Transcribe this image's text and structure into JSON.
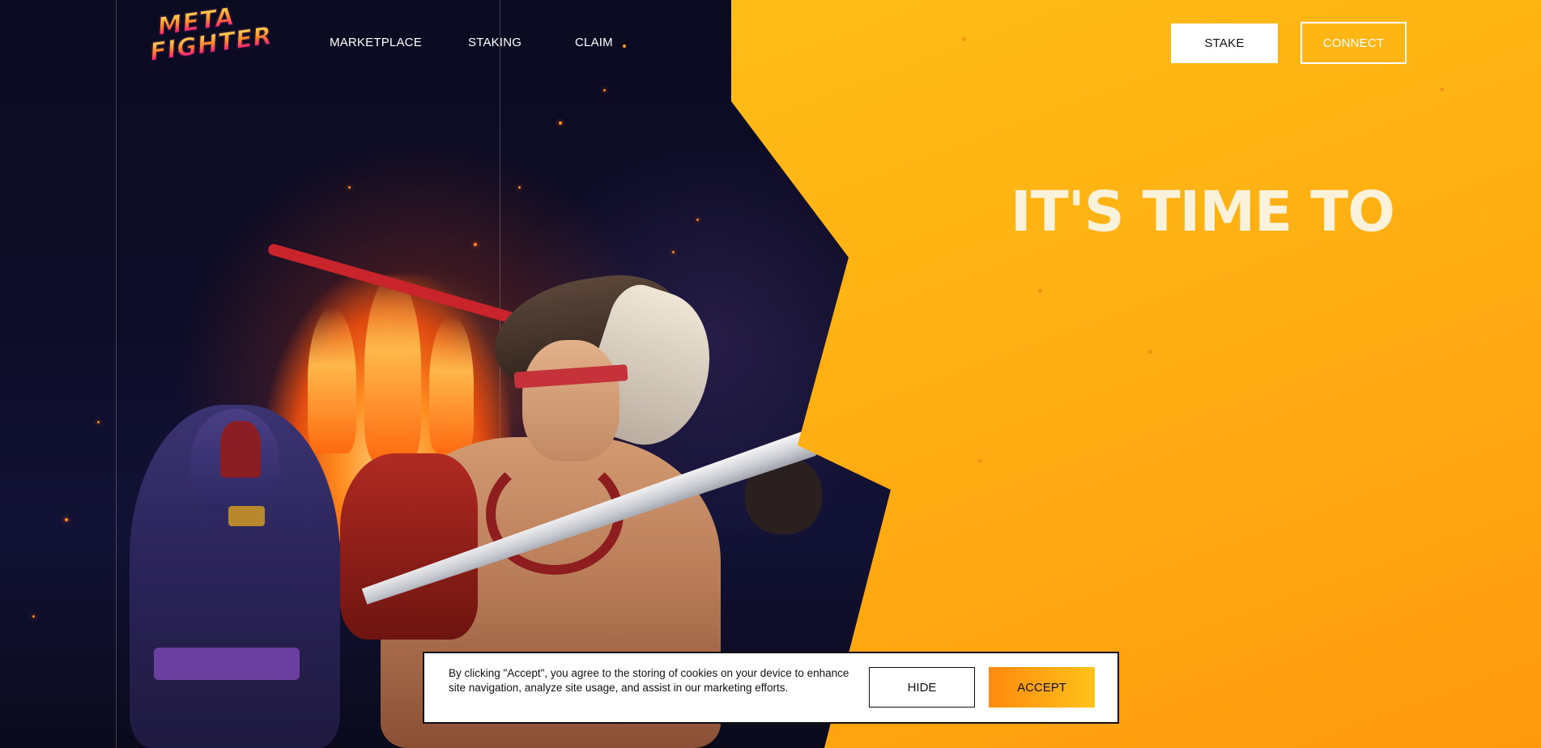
{
  "brand": {
    "logo_line1": "META",
    "logo_line2": "FIGHTER"
  },
  "nav": {
    "items": [
      {
        "label": "MARKETPLACE"
      },
      {
        "label": "STAKING"
      },
      {
        "label": "CLAIM"
      }
    ]
  },
  "header_buttons": {
    "stake_label": "STAKE",
    "connect_label": "CONNECT"
  },
  "hero": {
    "headline": "IT'S TIME TO"
  },
  "cookie_banner": {
    "text": "By clicking \"Accept\", you agree to the storing of cookies on your device to enhance site navigation, analyze site usage, and assist in our marketing efforts.",
    "hide_label": "HIDE",
    "accept_label": "ACCEPT"
  },
  "colors": {
    "accent_orange": "#ffb414",
    "dark_bg": "#0b0b22",
    "headline_text": "#fbf2dc"
  }
}
